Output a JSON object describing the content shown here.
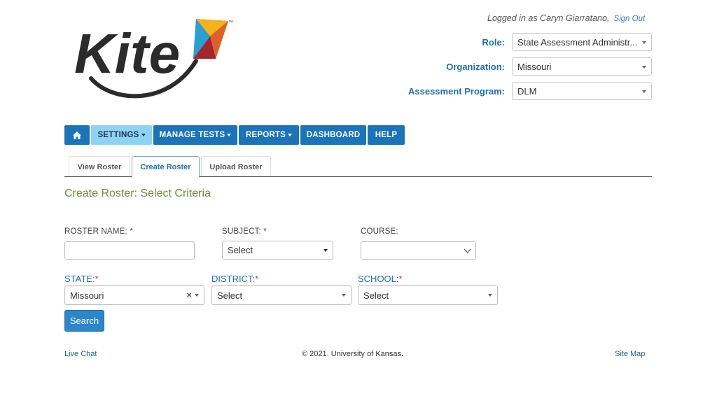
{
  "header": {
    "logo_text": "Kite",
    "logo_tm": "™",
    "logged_in_text": "Logged in as Caryn Giarratano,",
    "sign_out": "Sign Out",
    "role_label": "Role:",
    "role_value": "State Assessment Administr...",
    "organization_label": "Organization:",
    "organization_value": "Missouri",
    "program_label": "Assessment Program:",
    "program_value": "DLM"
  },
  "nav": {
    "home_icon": "home-icon",
    "items": [
      "SETTINGS",
      "MANAGE TESTS",
      "REPORTS",
      "DASHBOARD",
      "HELP"
    ]
  },
  "tabs": [
    "View Roster",
    "Create Roster",
    "Upload Roster"
  ],
  "page_title": "Create Roster: Select Criteria",
  "form": {
    "roster_name_label": "ROSTER NAME: *",
    "roster_name_value": "",
    "subject_label": "SUBJECT: *",
    "subject_value": "Select",
    "course_label": "COURSE:",
    "course_value": "",
    "state_label": "STATE:",
    "state_value": "Missouri",
    "district_label": "DISTRICT:",
    "district_value": "Select",
    "school_label": "SCHOOL:",
    "school_value": "Select",
    "required_mark": "*",
    "search_button": "Search"
  },
  "footer": {
    "live_chat": "Live Chat",
    "copyright": "© 2021. University of Kansas.",
    "site_map": "Site Map"
  },
  "colors": {
    "nav_blue": "#1b73ba",
    "nav_active": "#8fd3f3",
    "title_green": "#6b8c3e",
    "label_blue": "#1f6fb2"
  }
}
